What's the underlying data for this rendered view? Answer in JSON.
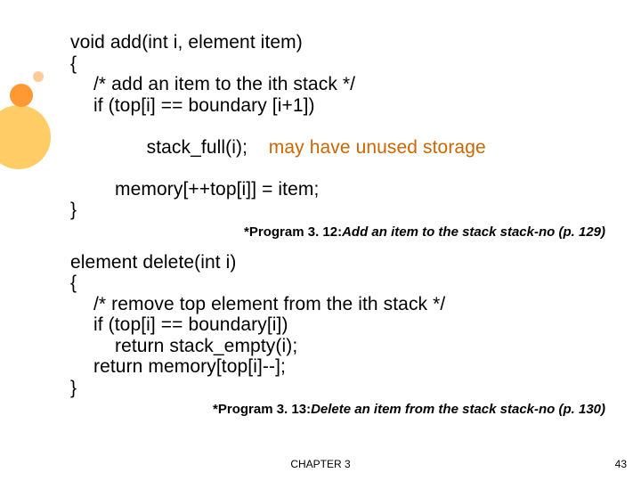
{
  "block1": {
    "l0": "void add(int i, element item)",
    "l1": "{",
    "l2": "/* add an item to the ith stack */",
    "l3": "if (top[i] == boundary [i+1])",
    "l4a": "stack_full(i);",
    "l4b": "may have unused storage",
    "l5": "memory[++top[i]] = item;",
    "l6": "}"
  },
  "caption1_prefix": "*Program 3. 12:",
  "caption1_rest": "Add an item to the stack stack-no (p. 129)",
  "block2": {
    "l0": "element delete(int i)",
    "l1": "{",
    "l2": "/* remove top element from the ith stack */",
    "l3": "if (top[i] == boundary[i])",
    "l4": "return stack_empty(i);",
    "l5": "return memory[top[i]--];",
    "l6": "}"
  },
  "caption2_prefix": "*Program 3. 13:",
  "caption2_rest": "Delete an item from the stack stack-no (p. 130)",
  "footer_center": "CHAPTER 3",
  "footer_right": "43"
}
